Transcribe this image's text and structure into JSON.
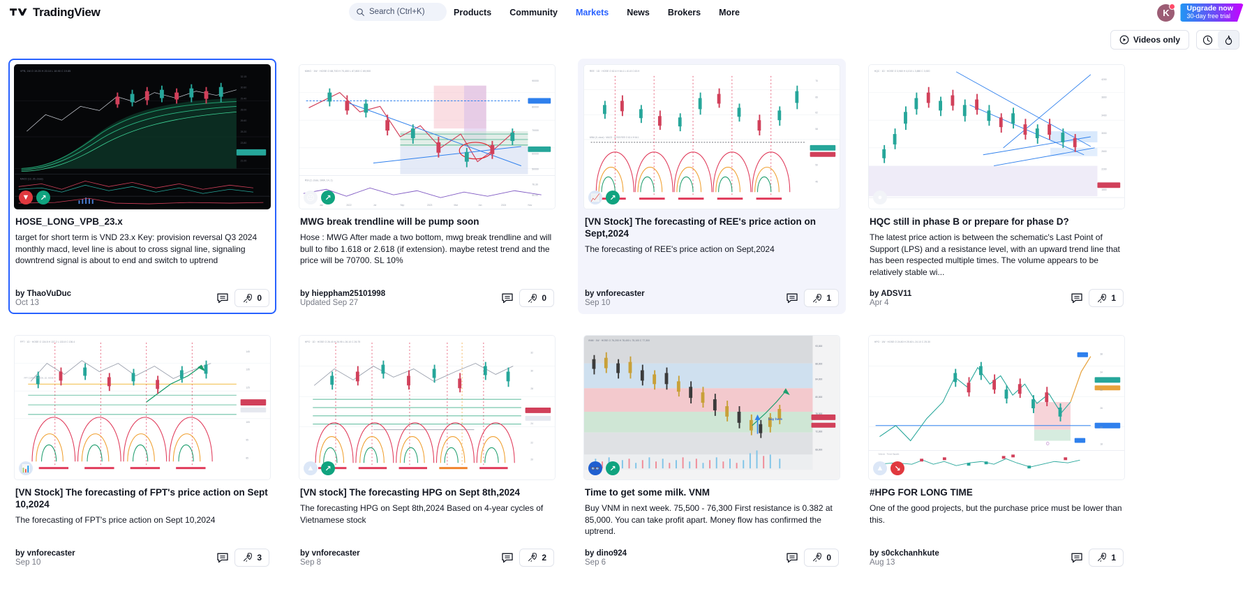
{
  "header": {
    "brand": "TradingView",
    "logo_icon": "tradingview-logo-icon",
    "search": {
      "placeholder": "Search (Ctrl+K)",
      "icon": "search-icon"
    },
    "nav": [
      {
        "label": "Products",
        "active": false
      },
      {
        "label": "Community",
        "active": false
      },
      {
        "label": "Markets",
        "active": true
      },
      {
        "label": "News",
        "active": false
      },
      {
        "label": "Brokers",
        "active": false
      },
      {
        "label": "More",
        "active": false
      }
    ],
    "avatar": {
      "initial": "K",
      "has_notification": true,
      "color": "#9c5d75"
    },
    "upgrade": {
      "line1": "Upgrade now",
      "line2": "30-day free trial"
    },
    "accent_color": "#2962ff"
  },
  "toolbar": {
    "videos_only": {
      "label": "Videos only",
      "icon": "play-circle-icon"
    },
    "sort": [
      {
        "icon": "clock-icon",
        "name": "sort-recent",
        "active": false
      },
      {
        "icon": "flame-icon",
        "name": "sort-popular",
        "active": true
      }
    ]
  },
  "cards": [
    {
      "state": "selected",
      "thumb": "dark",
      "title": "HOSE_LONG_VPB_23.x",
      "desc": "target for short term is VND 23.x Key: provision reversal Q3 2024 monthly macd, level line is about to cross signal line, signaling downtrend signal is about to end and switch to uptrend",
      "author": "by ThaoVuDuc",
      "date": "Oct 13",
      "boosts": "0",
      "badges": [
        "red",
        "green"
      ]
    },
    {
      "state": "normal",
      "thumb": "light",
      "title": "MWG break trendline will be pump soon",
      "desc": "Hose : MWG After made a two bottom, mwg break trendline and will bull to fibo 1.618 or 2.618 (if extension). maybe retest trend and the price will be 70700. SL 10%",
      "author": "by hieppham25101998",
      "date": "Updated Sep 27",
      "boosts": "0",
      "badges": [
        "white",
        "green"
      ]
    },
    {
      "state": "hovered",
      "thumb": "light",
      "title": "[VN Stock] The forecasting of REE's price action on Sept,2024",
      "desc": "The forecasting of REE's price action on Sept,2024",
      "author": "by vnforecaster",
      "date": "Sep 10",
      "boosts": "1",
      "badges": [
        "ltblue",
        "green"
      ]
    },
    {
      "state": "normal",
      "thumb": "light",
      "title": "HQC still in phase B or prepare for phase D?",
      "desc": "The latest price action is between the schematic's Last Point of Support (LPS) and a resistance level, with an upward trend line that has been respected multiple times. The volume appears to be relatively stable wi...",
      "author": "by ADSV11",
      "date": "Apr 4",
      "boosts": "1",
      "badges": [
        "white"
      ]
    },
    {
      "state": "normal",
      "thumb": "light",
      "title": "[VN Stock] The forecasting of FPT's price action on Sept 10,2024",
      "desc": "The forecasting of FPT's price action on Sept 10,2024",
      "author": "by vnforecaster",
      "date": "Sep 10",
      "boosts": "3",
      "badges": [
        "ltblue"
      ]
    },
    {
      "state": "normal",
      "thumb": "light",
      "title": "[VN stock] The forecasting HPG on Sept 8th,2024",
      "desc": "The forecasting HPG on Sept 8th,2024 Based on 4-year cycles of Vietnamese stock",
      "author": "by vnforecaster",
      "date": "Sep 8",
      "boosts": "2",
      "badges": [
        "ltblue",
        "green"
      ]
    },
    {
      "state": "normal",
      "thumb": "light",
      "title": "Time to get some milk. VNM",
      "desc": "Buy VNM in next week. 75,500 - 76,300 First resistance is 0.382 at 85,000. You can take profit apart. Money flow has confirmed the uptrend.",
      "author": "by dino924",
      "date": "Sep 6",
      "boosts": "0",
      "badges": [
        "blue",
        "green"
      ],
      "annotation": "buy here"
    },
    {
      "state": "normal",
      "thumb": "light",
      "title": "#HPG FOR LONG TIME",
      "desc": "One of the good projects, but the purchase price must be lower than this.",
      "author": "by s0ckchanhkute",
      "date": "Aug 13",
      "boosts": "1",
      "badges": [
        "ltblue",
        "red"
      ]
    }
  ]
}
